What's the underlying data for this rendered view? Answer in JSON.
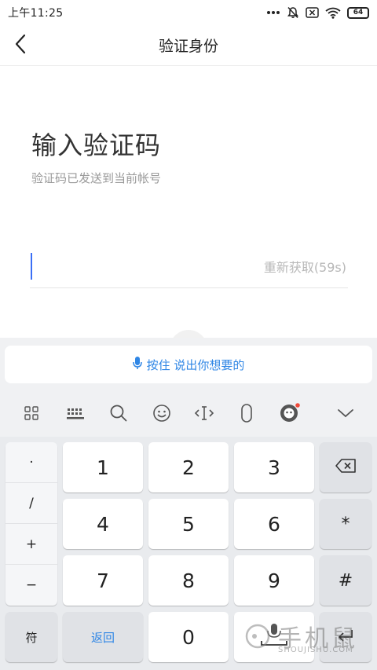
{
  "status_bar": {
    "time": "上午11:25",
    "battery": "64"
  },
  "nav": {
    "title": "验证身份"
  },
  "content": {
    "heading": "输入验证码",
    "subtext": "验证码已发送到当前帐号",
    "resend": "重新获取(59s)"
  },
  "ime": {
    "voice_label": "按住 说出你想要的",
    "toolbar_icons": [
      "grid-icon",
      "keyboard-icon",
      "search-icon",
      "emoji-icon",
      "cursor-move-icon",
      "microphone-icon",
      "assistant-icon",
      "collapse-icon"
    ],
    "symbols": [
      "·",
      "/",
      "+",
      "−"
    ],
    "digits": [
      "1",
      "2",
      "3",
      "4",
      "5",
      "6",
      "7",
      "8",
      "9",
      "0"
    ],
    "right_keys": [
      "*",
      "#"
    ],
    "symbol_key": "符",
    "return_key": "返回",
    "accent": "#2f86e5"
  },
  "watermark": {
    "text": "手机鼠",
    "subtext": "SHOUJISHU.COM"
  }
}
